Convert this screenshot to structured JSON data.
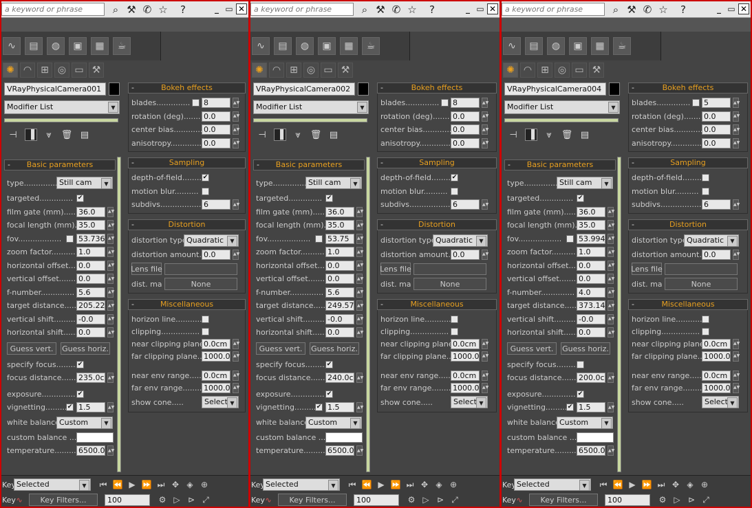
{
  "common": {
    "search_placeholder": "a keyword or phrase",
    "help_icon": "?",
    "window_buttons": [
      "_",
      "▭",
      "✕"
    ],
    "modifier_list": "Modifier List",
    "rollouts": {
      "bokeh": "Bokeh effects",
      "sampling": "Sampling",
      "distortion": "Distortion",
      "misc": "Miscellaneous",
      "basic": "Basic parameters"
    },
    "labels": {
      "blades": "blades..............",
      "rotation": "rotation (deg).......",
      "center_bias": "center bias............",
      "anisotropy": "anisotropy.............",
      "dof": "depth-of-field........",
      "motion_blur": "motion blur..........",
      "subdivs": "subdivs.................",
      "distortion_type": "distortion type.",
      "distortion_amount": "distortion amount...",
      "lens_file": "Lens file",
      "dist_map": "dist. map",
      "none": "None",
      "horizon_line": "horizon line...........",
      "clipping": "clipping................",
      "near_clip": "near clipping plane..",
      "far_clip": "far clipping plane...",
      "near_env": "near env range........",
      "far_env": "far env range.........",
      "show_cone": "show cone.....",
      "type": "type..............",
      "targeted": "targeted..............",
      "film_gate": "film gate (mm).......",
      "focal_length": "focal length (mm)....",
      "fov": "fov..................",
      "zoom_factor": "zoom factor..........",
      "h_offset": "horizontal offset.....",
      "v_offset": "vertical offset.......",
      "f_number": "f-number..............",
      "target_distance": "target distance.......",
      "v_shift": "vertical shift.........",
      "h_shift": "horizontal shift......",
      "guess_vert": "Guess vert.",
      "guess_horiz": "Guess horiz.",
      "specify_focus": "specify focus.........",
      "focus_distance": "focus distance........",
      "exposure": "exposure..............",
      "vignetting": "vignetting..........",
      "white_balance": "white balance",
      "custom_balance": "custom balance ......",
      "temperature": "temperature.........."
    },
    "bottom": {
      "key": "Key",
      "selected": "Selected",
      "key_filters": "Key Filters...",
      "frame": "100"
    }
  },
  "panels": [
    {
      "camera_name": "VRayPhysicalCamera001",
      "blades": "8",
      "blades_checked": false,
      "rotation": "0.0",
      "center_bias": "0.0",
      "anisotropy": "0.0",
      "dof_checked": true,
      "motion_blur_checked": false,
      "subdivs": "6",
      "distortion_type": "Quadratic",
      "distortion_amount": "0.0",
      "horizon_checked": false,
      "clipping_checked": false,
      "near_clip": "0.0cm",
      "far_clip": "1000.0c",
      "near_env": "0.0cm",
      "far_env": "1000.0c",
      "show_cone": "Selected",
      "type": "Still cam",
      "targeted_checked": true,
      "film_gate": "36.0",
      "focal_length": "35.0",
      "fov_checked": false,
      "fov": "53.736",
      "zoom_factor": "1.0",
      "h_offset": "0.0",
      "v_offset": "0.0",
      "f_number": "5.6",
      "target_distance": "205.226",
      "v_shift": "-0.0",
      "h_shift": "0.0",
      "specify_focus_checked": true,
      "focus_distance": "235.0cm",
      "exposure_checked": true,
      "vignetting_checked": true,
      "vignetting": "1.5",
      "white_balance": "Custom",
      "temperature": "6500.0"
    },
    {
      "camera_name": "VRayPhysicalCamera002",
      "blades": "8",
      "blades_checked": false,
      "rotation": "0.0",
      "center_bias": "0.0",
      "anisotropy": "0.0",
      "dof_checked": true,
      "motion_blur_checked": false,
      "subdivs": "6",
      "distortion_type": "Quadratic",
      "distortion_amount": "0.0",
      "horizon_checked": false,
      "clipping_checked": false,
      "near_clip": "0.0cm",
      "far_clip": "1000.0c",
      "near_env": "0.0cm",
      "far_env": "1000.0c",
      "show_cone": "Selected",
      "type": "Still cam",
      "targeted_checked": true,
      "film_gate": "36.0",
      "focal_length": "35.0",
      "fov_checked": false,
      "fov": "53.75",
      "zoom_factor": "1.0",
      "h_offset": "0.0",
      "v_offset": "0.0",
      "f_number": "5.6",
      "target_distance": "249.576",
      "v_shift": "-0.0",
      "h_shift": "0.0",
      "specify_focus_checked": true,
      "focus_distance": "240.0cm",
      "exposure_checked": true,
      "vignetting_checked": true,
      "vignetting": "1.5",
      "white_balance": "Custom",
      "temperature": "6500.0"
    },
    {
      "camera_name": "VRayPhysicalCamera004",
      "blades": "5",
      "blades_checked": false,
      "rotation": "0.0",
      "center_bias": "0.0",
      "anisotropy": "0.0",
      "dof_checked": false,
      "motion_blur_checked": false,
      "subdivs": "6",
      "distortion_type": "Quadratic",
      "distortion_amount": "0.0",
      "horizon_checked": false,
      "clipping_checked": false,
      "near_clip": "0.0cm",
      "far_clip": "1000.0c",
      "near_env": "0.0cm",
      "far_env": "1000.0c",
      "show_cone": "Selected",
      "type": "Still cam",
      "targeted_checked": true,
      "film_gate": "36.0",
      "focal_length": "35.0",
      "fov_checked": false,
      "fov": "53.994",
      "zoom_factor": "1.0",
      "h_offset": "0.0",
      "v_offset": "0.0",
      "f_number": "4.0",
      "target_distance": "373.148",
      "v_shift": "-0.0",
      "h_shift": "0.0",
      "specify_focus_checked": false,
      "focus_distance": "200.0cm",
      "exposure_checked": true,
      "vignetting_checked": true,
      "vignetting": "1.5",
      "white_balance": "Custom",
      "temperature": "6500.0"
    }
  ]
}
